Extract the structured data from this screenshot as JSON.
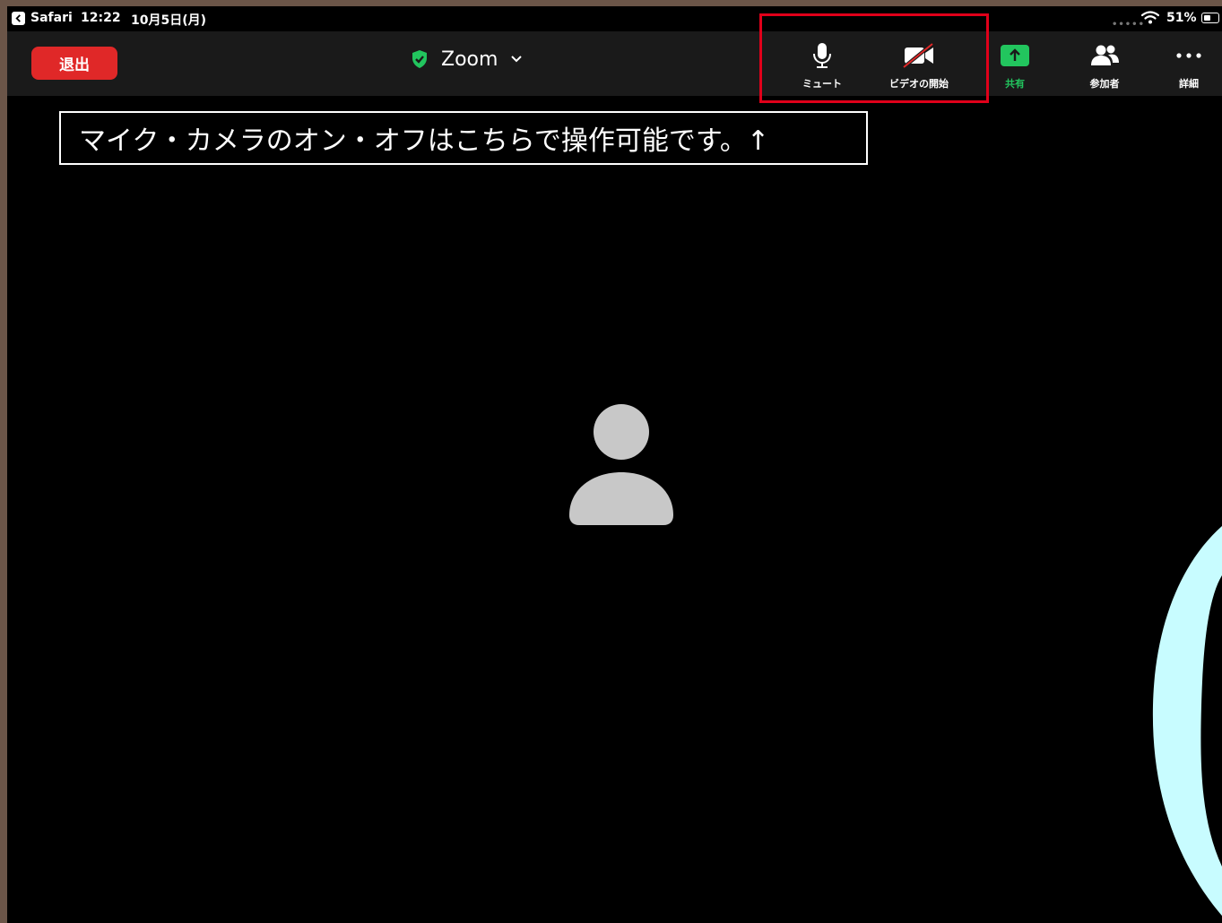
{
  "status_bar": {
    "app": "Safari",
    "time": "12:22",
    "date": "10月5日(月)",
    "cell_dots": "•••••",
    "battery_pct": "51%",
    "battery_level": 0.51
  },
  "toolbar": {
    "leave_label": "退出",
    "meeting_title": "Zoom",
    "mute_label": "ミュート",
    "video_label": "ビデオの開始",
    "share_label": "共有",
    "participants_label": "参加者",
    "more_label": "詳細"
  },
  "annotation": {
    "callout_text": "マイク・カメラのオン・オフはこちらで操作可能です。↑",
    "highlight_color": "#e0001a"
  },
  "colors": {
    "leave": "#e02828",
    "share": "#22c55e",
    "shield": "#22c55e",
    "toolbar_bg": "#1a1a1a",
    "avatar": "#c8c8c8",
    "cyan": "#c8fcff"
  },
  "icons": {
    "back": "chevron-left-icon",
    "wifi": "wifi-icon",
    "battery": "battery-icon",
    "shield": "shield-check-icon",
    "dropdown": "chevron-down-icon",
    "mic": "microphone-icon",
    "video": "video-off-icon",
    "share": "share-arrow-up-icon",
    "participants": "participants-icon",
    "more": "more-dots-icon",
    "avatar": "user-avatar-icon"
  }
}
